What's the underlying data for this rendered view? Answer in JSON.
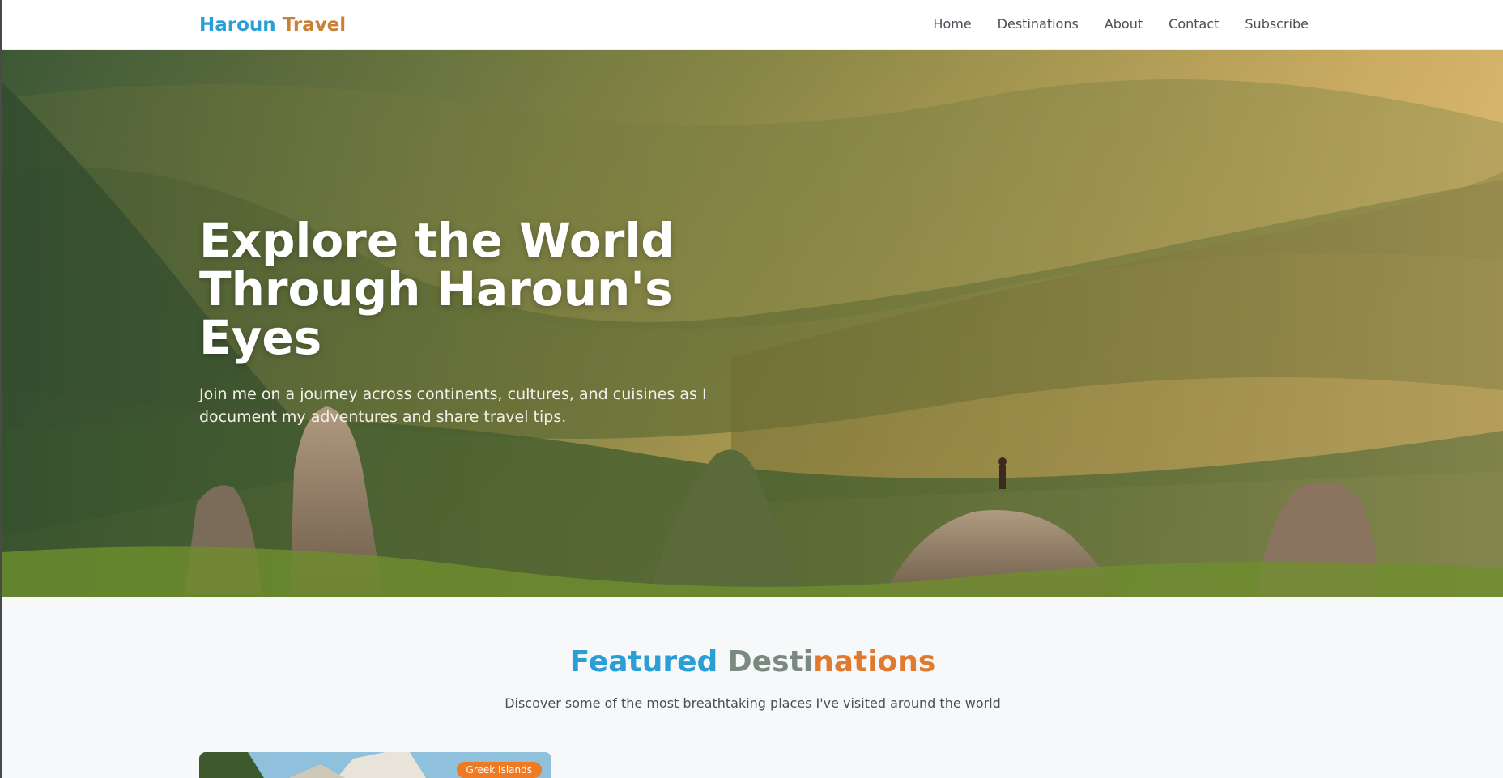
{
  "navbar": {
    "logo_part_a": "Haroun ",
    "logo_part_b": "Travel",
    "links": [
      {
        "label": "Home"
      },
      {
        "label": "Destinations"
      },
      {
        "label": "About"
      },
      {
        "label": "Contact"
      },
      {
        "label": "Subscribe"
      }
    ]
  },
  "hero": {
    "title": "Explore the World Through Haroun's Eyes",
    "subtitle": "Join me on a journey across continents, cultures, and cuisines as I document my adventures and share travel tips."
  },
  "featured": {
    "title_part_a": "Featured ",
    "title_part_b": "Desti",
    "title_part_c": "nations",
    "subtitle": "Discover some of the most breathtaking places I've visited around the world",
    "cards": [
      {
        "badge": "Greek Islands"
      }
    ]
  },
  "colors": {
    "brand_blue": "#2a9fd6",
    "brand_orange": "#e07a2e",
    "badge_orange": "#f07a22"
  }
}
